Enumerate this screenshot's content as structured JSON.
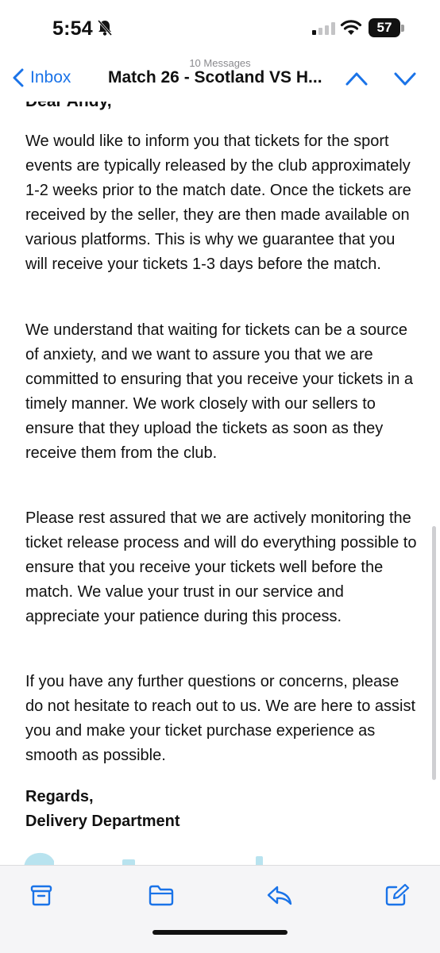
{
  "status_bar": {
    "time": "5:54",
    "battery": "57"
  },
  "nav": {
    "message_count": "10 Messages",
    "back_label": "Inbox",
    "subject": "Match 26 - Scotland VS H..."
  },
  "email": {
    "greeting_clipped": "Dear Andy,",
    "paragraphs": [
      "We would like to inform you that tickets for the sport events are typically released by the club approximately 1-2 weeks prior to the match date. Once the tickets are received by the seller, they are then made available on various platforms. This is why we guarantee that you will receive your tickets 1-3 days before the match.",
      "We understand that waiting for tickets can be a source of anxiety, and we want to assure you that we are committed to ensuring that you receive your tickets in a timely manner. We work closely with our sellers to ensure that they upload the tickets as soon as they receive them from the club.",
      "Please rest assured that we are actively monitoring the ticket release process and will do everything possible to ensure that you receive your tickets well before the match. We value your trust in our service and appreciate your patience during this process.",
      "If you have any further questions or concerns, please do not hesitate to reach out to us. We are here to assist you and make your ticket purchase experience as smooth as possible."
    ],
    "signoff": "Regards,",
    "signature": "Delivery Department"
  },
  "icons": {
    "mute": "bell-slash-icon",
    "archive": "archive-icon",
    "folder": "folder-icon",
    "reply": "reply-icon",
    "compose": "compose-icon"
  },
  "colors": {
    "accent": "#1a73e8",
    "text": "#111111",
    "toolbar_bg": "#f5f5f7",
    "logo": "#b8e3ef"
  }
}
